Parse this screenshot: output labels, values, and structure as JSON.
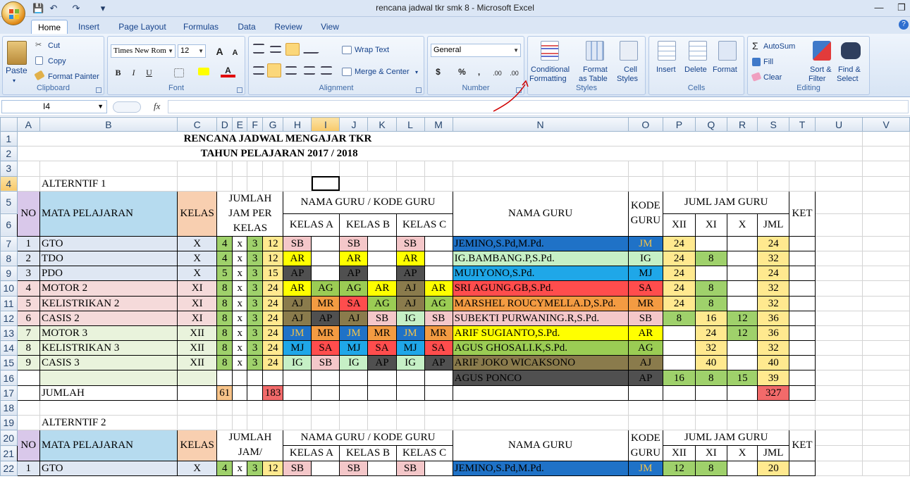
{
  "window": {
    "title": "rencana jadwal tkr smk 8  -  Microsoft Excel",
    "minimize": "—",
    "maximize": "❐"
  },
  "qat": {
    "save": "💾",
    "undo": "↶",
    "redo": "↷",
    "more": "▾"
  },
  "tabs": [
    "Home",
    "Insert",
    "Page Layout",
    "Formulas",
    "Data",
    "Review",
    "View"
  ],
  "ribbon": {
    "clipboard": {
      "label": "Clipboard",
      "paste": "Paste",
      "cut": "Cut",
      "copy": "Copy",
      "format_painter": "Format Painter"
    },
    "font": {
      "label": "Font",
      "name": "Times New Rom",
      "size": "12",
      "bold": "B",
      "italic": "I",
      "underline": "U",
      "grow": "A",
      "shrink": "A"
    },
    "alignment": {
      "label": "Alignment",
      "wrap": "Wrap Text",
      "merge": "Merge & Center"
    },
    "number": {
      "label": "Number",
      "format": "General",
      "currency": "$",
      "percent": "%",
      "comma": ",",
      "inc": ".00",
      "dec": ".00"
    },
    "styles": {
      "label": "Styles",
      "conditional_1": "Conditional",
      "conditional_2": "Formatting",
      "table_1": "Format",
      "table_2": "as Table",
      "cell_1": "Cell",
      "cell_2": "Styles"
    },
    "cells": {
      "label": "Cells",
      "insert": "Insert",
      "delete": "Delete",
      "format": "Format"
    },
    "editing": {
      "label": "Editing",
      "autosum": "AutoSum",
      "fill": "Fill",
      "clear": "Clear",
      "sort_1": "Sort &",
      "sort_2": "Filter",
      "find_1": "Find &",
      "find_2": "Select"
    }
  },
  "formula_bar": {
    "name_box": "I4",
    "fx": "fx",
    "content": ""
  },
  "colors": {
    "sb": "#f4c7c9",
    "ar": "#ffff00",
    "ap": "#505050",
    "ag": "#9bcc54",
    "aj": "#8a7b4c",
    "mr": "#f39b42",
    "sa": "#ff4d4d",
    "ig": "#c6f0c6",
    "jm": "#1f72c7",
    "mj": "#1fa7e8",
    "pur": "#d9c8ea",
    "blu": "#b6dbef",
    "ora": "#f8cfb0",
    "yel": "#ffe98f",
    "grn": "#9fd16b"
  },
  "sheet": {
    "columns": [
      "A",
      "B",
      "C",
      "D",
      "E",
      "F",
      "G",
      "H",
      "I",
      "J",
      "K",
      "L",
      "M",
      "N",
      "O",
      "P",
      "Q",
      "R",
      "S",
      "T",
      "U",
      "V"
    ],
    "rows": [
      "1",
      "2",
      "3",
      "4",
      "5",
      "6",
      "7",
      "8",
      "9",
      "10",
      "11",
      "12",
      "13",
      "14",
      "15",
      "16",
      "17",
      "18",
      "19",
      "20",
      "21",
      "22"
    ],
    "title1": "RENCANA JADWAL MENGAJAR TKR",
    "title2": "TAHUN PELAJARAN 2017 / 2018",
    "alt1": "ALTERNTIF 1",
    "alt2": "ALTERNTIF 2",
    "h_no": "NO",
    "h_mapel": "MATA PELAJARAN",
    "h_kelas": "KELAS",
    "h_jumlah": "JUMLAH JAM PER KELAS",
    "h_jumlah2": "JUMLAH JAM/",
    "h_namaguru_kode": "NAMA GURU / KODE GURU",
    "h_kelas_a": "KELAS A",
    "h_kelas_b": "KELAS B",
    "h_kelas_c": "KELAS C",
    "h_namaguru": "NAMA GURU",
    "h_kode": "KODE GURU",
    "h_jml_jam": "JUML JAM GURU",
    "h_xii": "XII",
    "h_xi": "XI",
    "h_x": "X",
    "h_jml": "JML",
    "h_ket": "KET",
    "x": "x",
    "subjects": [
      {
        "no": "1",
        "name": "GTO",
        "kelas": "X",
        "d": "4",
        "f": "3",
        "g": "12"
      },
      {
        "no": "2",
        "name": "TDO",
        "kelas": "X",
        "d": "4",
        "f": "3",
        "g": "12"
      },
      {
        "no": "3",
        "name": "PDO",
        "kelas": "X",
        "d": "5",
        "f": "3",
        "g": "15"
      },
      {
        "no": "4",
        "name": "MOTOR 2",
        "kelas": "XI",
        "d": "8",
        "f": "3",
        "g": "24"
      },
      {
        "no": "5",
        "name": "KELISTRIKAN 2",
        "kelas": "XI",
        "d": "8",
        "f": "3",
        "g": "24"
      },
      {
        "no": "6",
        "name": "CASIS 2",
        "kelas": "XI",
        "d": "8",
        "f": "3",
        "g": "24"
      },
      {
        "no": "7",
        "name": "MOTOR 3",
        "kelas": "XII",
        "d": "8",
        "f": "3",
        "g": "24"
      },
      {
        "no": "8",
        "name": "KELISTRIKAN 3",
        "kelas": "XII",
        "d": "8",
        "f": "3",
        "g": "24"
      },
      {
        "no": "9",
        "name": "CASIS 3",
        "kelas": "XII",
        "d": "8",
        "f": "3",
        "g": "24"
      }
    ],
    "assign": [
      [
        "SB",
        "",
        "SB",
        "",
        "SB",
        ""
      ],
      [
        "AR",
        "",
        "AR",
        "",
        "AR",
        ""
      ],
      [
        "AP",
        "",
        "AP",
        "",
        "AP",
        ""
      ],
      [
        "AR",
        "AG",
        "AG",
        "AR",
        "AJ",
        "AR"
      ],
      [
        "AJ",
        "MR",
        "SA",
        "AG",
        "AJ",
        "AG"
      ],
      [
        "AJ",
        "AP",
        "AJ",
        "SB",
        "IG",
        "SB"
      ],
      [
        "JM",
        "MR",
        "JM",
        "MR",
        "JM",
        "MR"
      ],
      [
        "MJ",
        "SA",
        "MJ",
        "SA",
        "MJ",
        "SA"
      ],
      [
        "IG",
        "SB",
        "IG",
        "AP",
        "IG",
        "AP"
      ]
    ],
    "teachers": [
      {
        "name": "JEMINO,S.Pd,M.Pd.",
        "code": "JM",
        "xii": "24",
        "xi": "",
        "x": "",
        "jml": "24"
      },
      {
        "name": "IG.BAMBANG.P,S.Pd.",
        "code": "IG",
        "xii": "24",
        "xi": "8",
        "x": "",
        "jml": "32"
      },
      {
        "name": "MUJIYONO,S.Pd.",
        "code": "MJ",
        "xii": "24",
        "xi": "",
        "x": "",
        "jml": "24"
      },
      {
        "name": "SRI AGUNG.GB,S.Pd.",
        "code": "SA",
        "xii": "24",
        "xi": "8",
        "x": "",
        "jml": "32"
      },
      {
        "name": "MARSHEL ROUCYMELLA.D,S.Pd.",
        "code": "MR",
        "xii": "24",
        "xi": "8",
        "x": "",
        "jml": "32"
      },
      {
        "name": "SUBEKTI PURWANING.R,S.Pd.",
        "code": "SB",
        "xii": "8",
        "xi": "16",
        "x": "12",
        "jml": "36"
      },
      {
        "name": "ARIF SUGIANTO,S.Pd.",
        "code": "AR",
        "xii": "",
        "xi": "24",
        "x": "12",
        "jml": "36"
      },
      {
        "name": "AGUS GHOSALI.K,S.Pd.",
        "code": "AG",
        "xii": "",
        "xi": "32",
        "x": "",
        "jml": "32"
      },
      {
        "name": "ARIF JOKO WICAKSONO",
        "code": "AJ",
        "xii": "",
        "xi": "40",
        "x": "",
        "jml": "40"
      },
      {
        "name": "AGUS PONCO",
        "code": "AP",
        "xii": "16",
        "xi": "8",
        "x": "15",
        "jml": "39"
      }
    ],
    "jumlah_label": "JUMLAH",
    "jumlah_d": "61",
    "jumlah_g": "183",
    "jumlah_jml": "327",
    "alt2_row": {
      "no": "1",
      "name": "GTO",
      "kelas": "X",
      "d": "4",
      "f": "3",
      "g": "12",
      "a": "SB",
      "c": "SB",
      "e": "SB",
      "teacher": "JEMINO,S.Pd,M.Pd.",
      "code": "JM",
      "xii": "12",
      "xi": "8",
      "jml": "20"
    }
  }
}
